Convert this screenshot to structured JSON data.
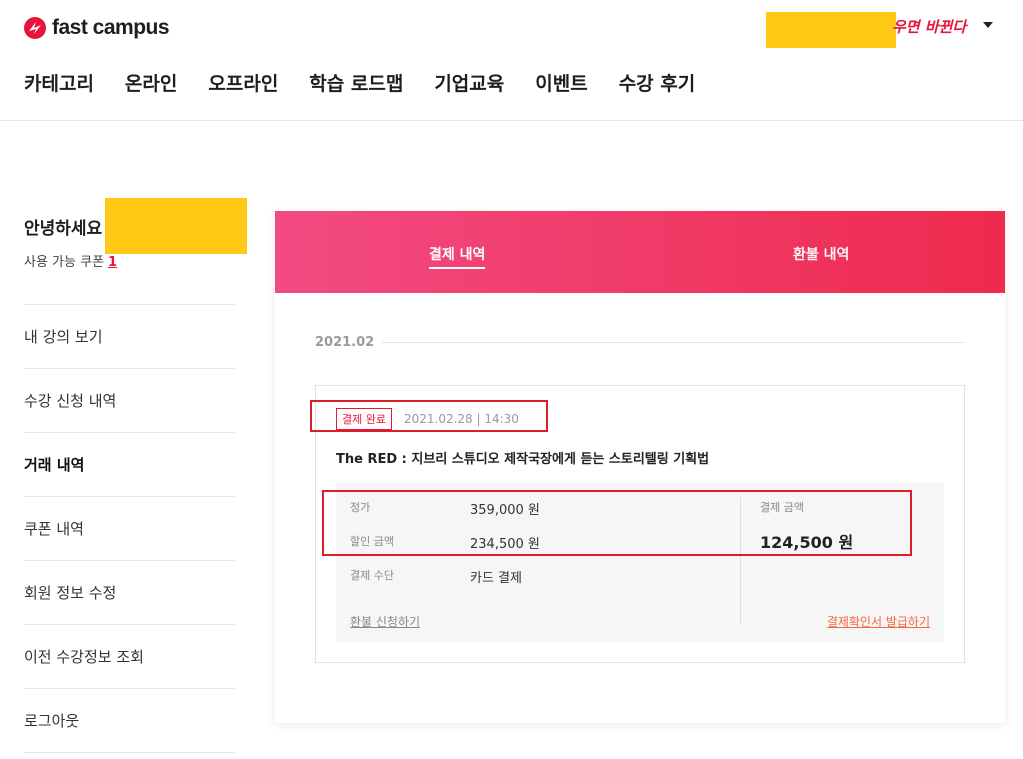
{
  "header": {
    "logo_text": "fast campus",
    "banner_text": "우면 바뀐다",
    "gnb": [
      "카테고리",
      "온라인",
      "오프라인",
      "학습 로드맵",
      "기업교육",
      "이벤트",
      "수강 후기"
    ]
  },
  "sidebar": {
    "greeting": "안녕하세요",
    "coupon_label": "사용 가능 쿠폰",
    "coupon_count": "1",
    "items": [
      "내 강의 보기",
      "수강 신청 내역",
      "거래 내역",
      "쿠폰 내역",
      "회원 정보 수정",
      "이전 수강정보 조회",
      "로그아웃"
    ],
    "active_index": 2
  },
  "tabs": {
    "payment": "결제 내역",
    "refund": "환불 내역"
  },
  "history": {
    "month": "2021.02",
    "order": {
      "status": "결제 완료",
      "datetime": "2021.02.28 | 14:30",
      "title": "The RED : 지브리 스튜디오 제작국장에게 듣는 스토리텔링 기획법",
      "price_label": "정가",
      "price_value": "359,000 원",
      "discount_label": "할인 금액",
      "discount_value": "234,500 원",
      "method_label": "결제 수단",
      "method_value": "카드 결제",
      "total_label": "결제 금액",
      "total_value": "124,500 원",
      "refund_link": "환불 신청하기",
      "receipt_link": "결제확인서 발급하기"
    }
  },
  "colors": {
    "brand": "#e8143d",
    "tab_gradient_start": "#f24b82",
    "tab_gradient_end": "#ee2a4e",
    "highlight_box": "#e01b2a",
    "mask": "#ffc916",
    "receipt_link": "#f26a3d"
  }
}
